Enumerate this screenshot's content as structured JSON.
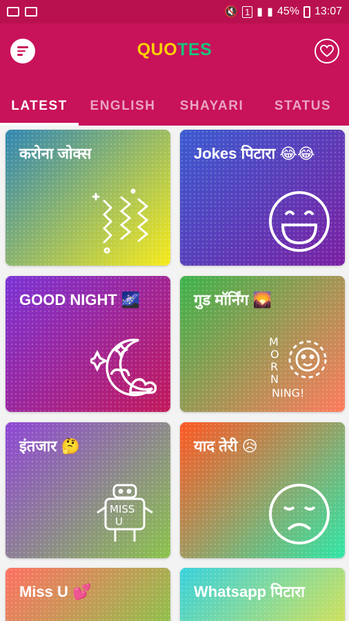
{
  "status_bar": {
    "battery": "45%",
    "time": "13:07",
    "sim": "1"
  },
  "app": {
    "title_parts": [
      "QUO",
      "TES"
    ],
    "title_colors": [
      "#ffd100",
      "#19c37d"
    ]
  },
  "tabs": [
    {
      "label": "LATEST"
    },
    {
      "label": "ENGLISH"
    },
    {
      "label": "SHAYARI"
    },
    {
      "label": "STATUS"
    }
  ],
  "cards": [
    {
      "label": "करोना जोक्स",
      "icon": "confetti-icon",
      "gradient": [
        "#2f86b3",
        "#f7ea19"
      ]
    },
    {
      "label": "Jokes पिटारा 😂😂",
      "icon": "laughing-face-icon",
      "gradient": [
        "#3a5bd1",
        "#7a1fa2"
      ]
    },
    {
      "label": "GOOD NIGHT 🌌",
      "icon": "moon-icon",
      "gradient": [
        "#7a33d6",
        "#c2185b"
      ]
    },
    {
      "label": "गुड मॉर्निंग 🌄",
      "icon": "morning-sun-icon",
      "gradient": [
        "#3bb34a",
        "#ff7a5c"
      ]
    },
    {
      "label": "इंतजार 🤔",
      "icon": "miss-u-robot-icon",
      "gradient": [
        "#8e44d6",
        "#8bc34a"
      ]
    },
    {
      "label": "याद तेरी 😥",
      "icon": "sad-face-icon",
      "gradient": [
        "#ff5722",
        "#2ee6a6"
      ]
    },
    {
      "label": "Miss U 💕",
      "icon": "heart-icon",
      "gradient": [
        "#ff6f61",
        "#8bc34a"
      ]
    },
    {
      "label": "Whatsapp पिटारा",
      "icon": "chat-icon",
      "gradient": [
        "#36d1dc",
        "#d4e157"
      ]
    }
  ]
}
